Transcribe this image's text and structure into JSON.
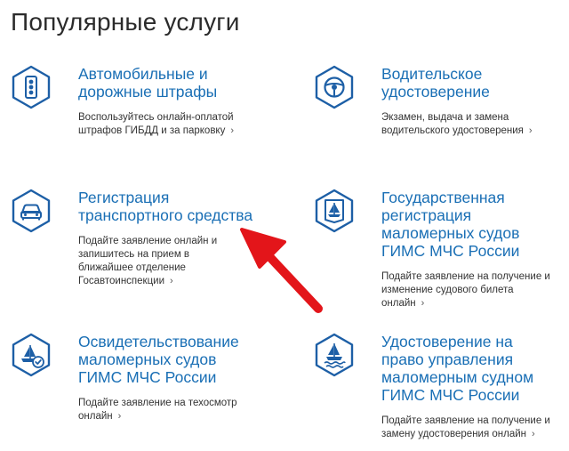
{
  "page": {
    "title": "Популярные услуги"
  },
  "services": [
    {
      "title": "Автомобильные и\nдорожные штрафы",
      "description": "Воспользуйтесь онлайн-оплатой\nштрафов ГИБДД и за парковку",
      "icon": "traffic-light-icon"
    },
    {
      "title": "Водительское\nудостоверение",
      "description": "Экзамен, выдача и замена\nводительского удостоверения",
      "icon": "steering-wheel-icon"
    },
    {
      "title": "Регистрация\nтранспортного средства",
      "description": "Подайте заявление онлайн и\nзапишитесь на прием в\nближайшее отделение\nГосавтоинспекции",
      "icon": "car-icon"
    },
    {
      "title": "Государственная\nрегистрация\nмаломерных судов\nГИМС МЧС России",
      "description": "Подайте заявление на получение и\nизменение судового билета\nонлайн",
      "icon": "boat-document-icon"
    },
    {
      "title": "Освидетельствование\nмаломерных судов\nГИМС МЧС России",
      "description": "Подайте заявление на техосмотр\nонлайн",
      "icon": "boat-check-icon"
    },
    {
      "title": "Удостоверение на\nправо управления\nмаломерным судном\nГИМС МЧС России",
      "description": "Подайте заявление на получение и\nзамену удостоверения онлайн",
      "icon": "boat-waves-icon"
    }
  ],
  "chevron": "›",
  "colors": {
    "accent": "#1a6fb5",
    "icon": "#1d5fa6",
    "arrow": "#e3151a"
  }
}
